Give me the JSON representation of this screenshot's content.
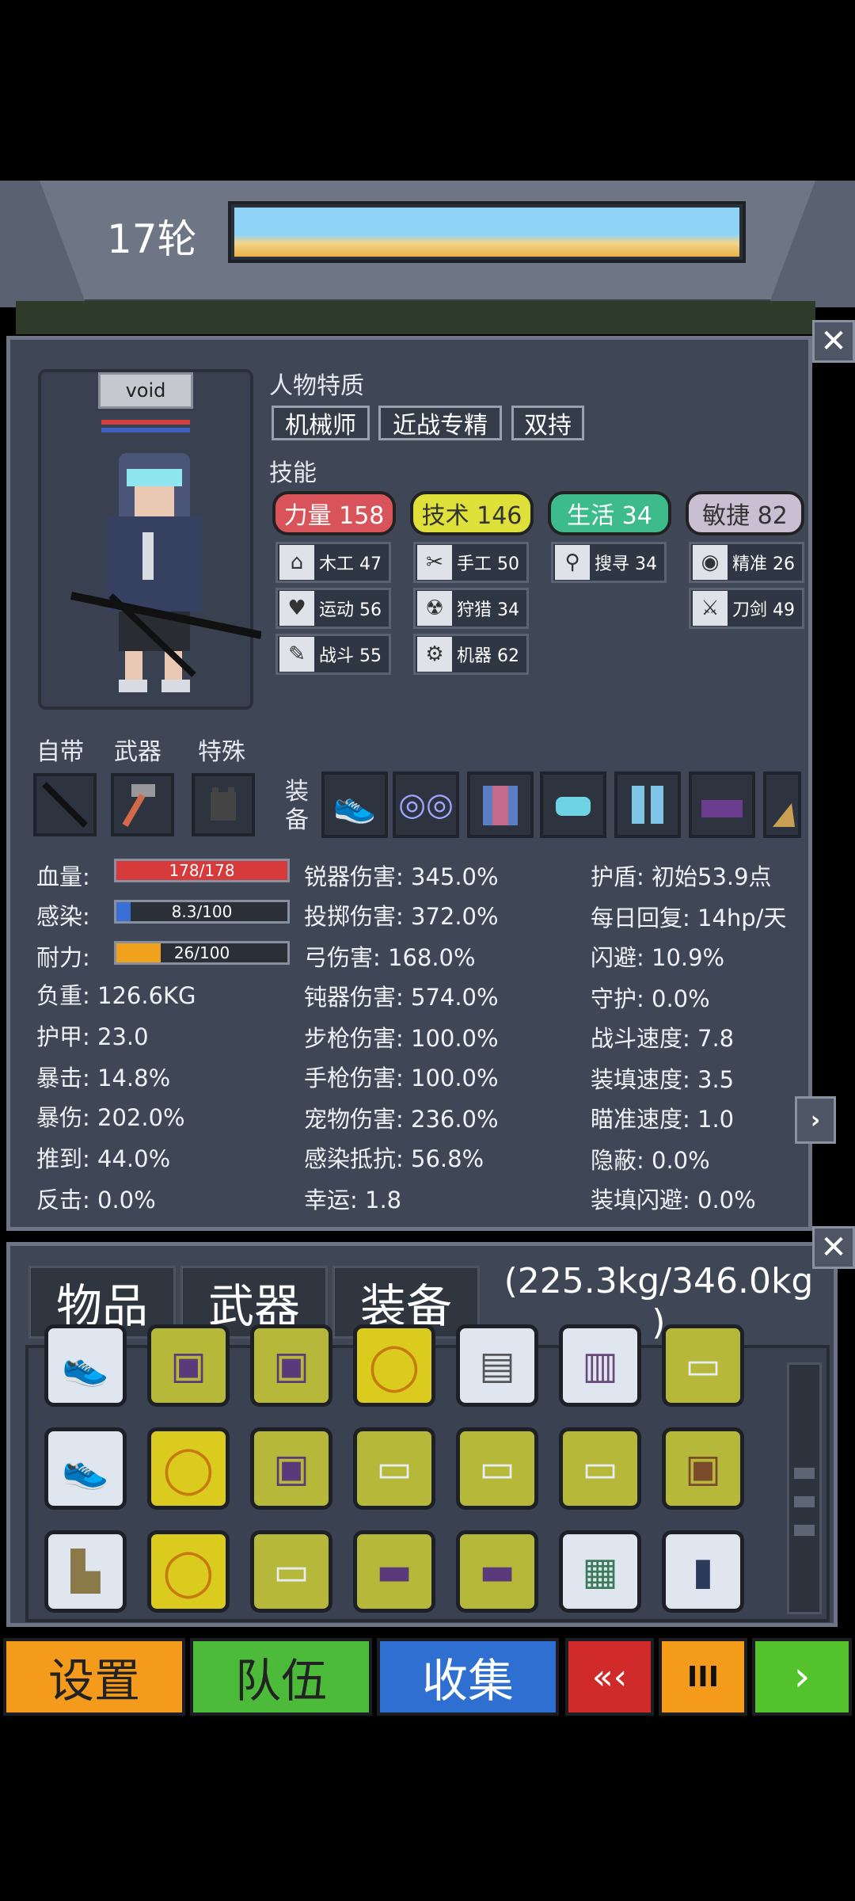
{
  "header": {
    "round": "17轮"
  },
  "character": {
    "name": "void"
  },
  "traits": {
    "title": "人物特质",
    "items": [
      "机械师",
      "近战专精",
      "双持"
    ]
  },
  "skills": {
    "title": "技能",
    "categories": [
      {
        "label": "力量 158",
        "color": "#d9545a"
      },
      {
        "label": "技术 146",
        "color": "#dfe13a"
      },
      {
        "label": "生活 34",
        "color": "#3dbb8c"
      },
      {
        "label": "敏捷 82",
        "color": "#c9bfd3"
      }
    ],
    "sub": [
      {
        "label": "木工 47",
        "icon": "house-icon"
      },
      {
        "label": "运动 56",
        "icon": "heart-icon"
      },
      {
        "label": "战斗 55",
        "icon": "wrench-icon"
      },
      {
        "label": "手工 50",
        "icon": "scissors-icon"
      },
      {
        "label": "狩猎 34",
        "icon": "radiation-icon"
      },
      {
        "label": "机器 62",
        "icon": "gear-icon"
      },
      {
        "label": "搜寻 34",
        "icon": "magnifier-icon"
      },
      {
        "label": "精准 26",
        "icon": "eye-icon"
      },
      {
        "label": "刀剑 49",
        "icon": "sword-icon"
      }
    ]
  },
  "slots": {
    "builtin": "自带",
    "weapon": "武器",
    "special": "特殊",
    "equipment": "装\n备"
  },
  "stats": {
    "col1": [
      {
        "label": "血量:",
        "value": "178/178",
        "bar": true,
        "fill": 1.0,
        "color": "#d63a3a"
      },
      {
        "label": "感染:",
        "value": "8.3/100",
        "bar": true,
        "fill": 0.083,
        "color": "#3a6fd6"
      },
      {
        "label": "耐力:",
        "value": "26/100",
        "bar": true,
        "fill": 0.26,
        "color": "#f0a21c"
      },
      {
        "label": "负重:",
        "value": "126.6KG"
      },
      {
        "label": "护甲:",
        "value": "23.0"
      },
      {
        "label": "暴击:",
        "value": "14.8%"
      },
      {
        "label": "暴伤:",
        "value": "202.0%"
      },
      {
        "label": "推到:",
        "value": "44.0%"
      },
      {
        "label": "反击:",
        "value": "0.0%"
      }
    ],
    "col2": [
      "锐器伤害:  345.0%",
      "投掷伤害:  372.0%",
      "弓伤害:  168.0%",
      "钝器伤害:  574.0%",
      "步枪伤害:  100.0%",
      "手枪伤害:  100.0%",
      "宠物伤害:  236.0%",
      "感染抵抗:  56.8%",
      "幸运:  1.8"
    ],
    "col3": [
      "护盾:  初始53.9点",
      "每日回复:  14hp/天",
      "闪避:  10.9%",
      "守护:  0.0%",
      "战斗速度:  7.8",
      "装填速度:  3.5",
      "瞄准速度:  1.0",
      "隐蔽:  0.0%",
      "装填闪避:  0.0%"
    ]
  },
  "inventory": {
    "tabs": [
      "物品",
      "武器",
      "装备"
    ],
    "weight": "(225.3kg/346.0kg\n)"
  },
  "bottom": {
    "settings": "设置",
    "team": "队伍",
    "collect": "收集",
    "rewind": "«‹",
    "pause": "III",
    "next": "›"
  }
}
